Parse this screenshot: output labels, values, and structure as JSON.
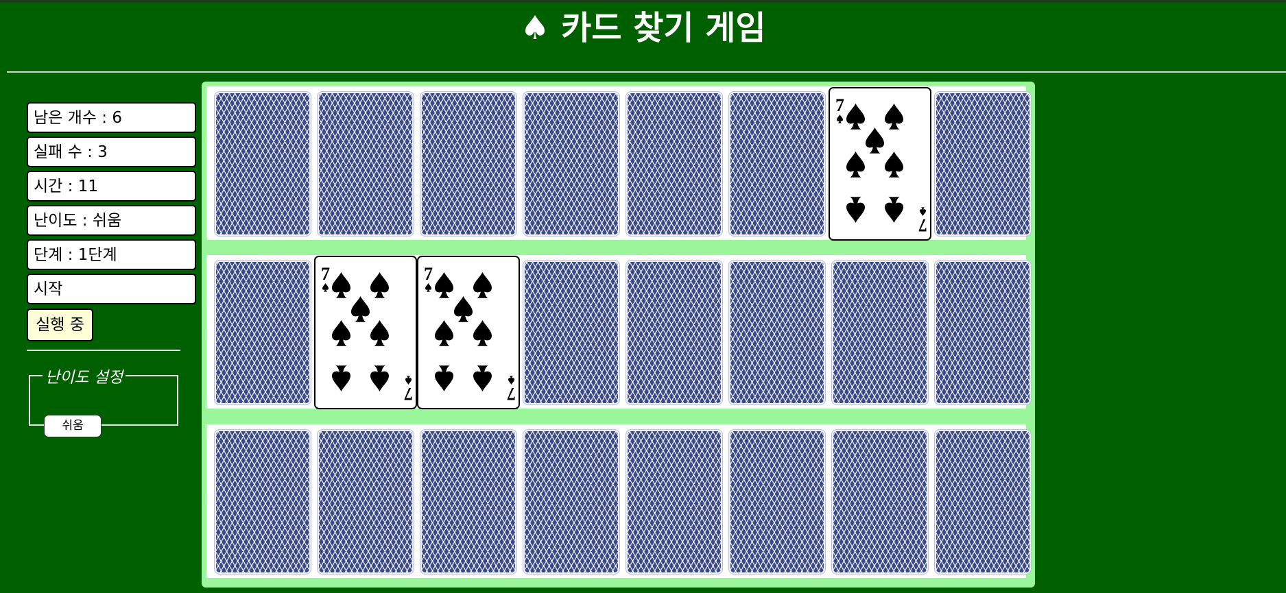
{
  "header": {
    "icon": "spade-icon",
    "title": "♠ 카드 찾기 게임"
  },
  "sidebar": {
    "remaining": "남은 개수 : 6",
    "failures": "실패 수 : 3",
    "time": "시간 : 11",
    "difficulty": "난이도 : 쉬움",
    "stage": "단계 : 1단계",
    "start": "시작",
    "running": "실행 중",
    "difficulty_settings": {
      "legend": "난이도 설정",
      "easy_button": "쉬움"
    }
  },
  "board": {
    "rows": [
      {
        "cards": [
          {
            "state": "back"
          },
          {
            "state": "back"
          },
          {
            "state": "back"
          },
          {
            "state": "back"
          },
          {
            "state": "back"
          },
          {
            "state": "back"
          },
          {
            "state": "face",
            "rank": "7",
            "suit": "spade"
          },
          {
            "state": "back"
          }
        ]
      },
      {
        "cards": [
          {
            "state": "back"
          },
          {
            "state": "face",
            "rank": "7",
            "suit": "spade"
          },
          {
            "state": "face",
            "rank": "7",
            "suit": "spade"
          },
          {
            "state": "back"
          },
          {
            "state": "back"
          },
          {
            "state": "back"
          },
          {
            "state": "back"
          },
          {
            "state": "back"
          }
        ]
      },
      {
        "cards": [
          {
            "state": "back"
          },
          {
            "state": "back"
          },
          {
            "state": "back"
          },
          {
            "state": "back"
          },
          {
            "state": "back"
          },
          {
            "state": "back"
          },
          {
            "state": "back"
          },
          {
            "state": "back"
          }
        ]
      }
    ]
  },
  "colors": {
    "background": "#006000",
    "board_border": "#9bf59b",
    "card_back": "#3b4a86",
    "running_button": "#ffffd8"
  }
}
